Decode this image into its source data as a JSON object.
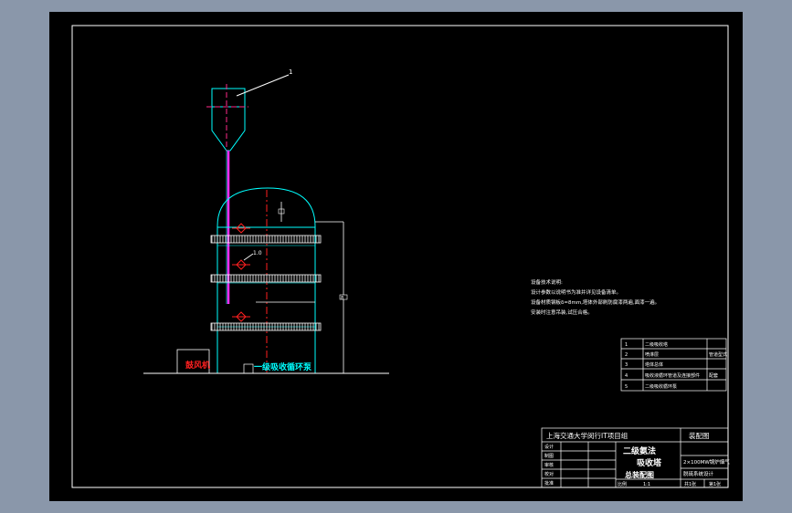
{
  "labels": {
    "callout_1": "1",
    "fan_label": "鼓风机",
    "circulation_label": "一级吸收循环泵",
    "dim_side": "8",
    "valve_mark": "1.0"
  },
  "notes": {
    "title": "设备技术说明:",
    "line1": "设计参数以说明书为准并详见设备清单。",
    "line2": "设备材质钢板δ=8mm,塔体外部刷防腐漆两遍,面漆一遍。",
    "line3": "安装时注意吊装,试压合格。"
  },
  "parts_table": {
    "rows": [
      {
        "no": "1",
        "name": "二级吸收塔",
        "spec": ""
      },
      {
        "no": "2",
        "name": "喷淋层",
        "spec": "管道型式"
      },
      {
        "no": "3",
        "name": "塔体总体",
        "spec": ""
      },
      {
        "no": "4",
        "name": "吸收液循环管道及连接部件",
        "spec": "配套"
      },
      {
        "no": "5",
        "name": "二级吸收循环泵",
        "spec": ""
      }
    ]
  },
  "title_block": {
    "school": "上海交通大学闵行IT项目组",
    "drawing_kind": "装配图",
    "title_main": "二级氨法",
    "title_sub": "吸收塔",
    "title_sheet": "总装配图",
    "project": "2×100MW锅炉烟气",
    "project_sub": "脱硫系统设计",
    "roles": [
      "设计",
      "制图",
      "审核",
      "校对",
      "批准"
    ],
    "scale_label": "比例",
    "scale_value": "1:1",
    "sheet_label": "共1张",
    "sheet_no": "第1张"
  }
}
